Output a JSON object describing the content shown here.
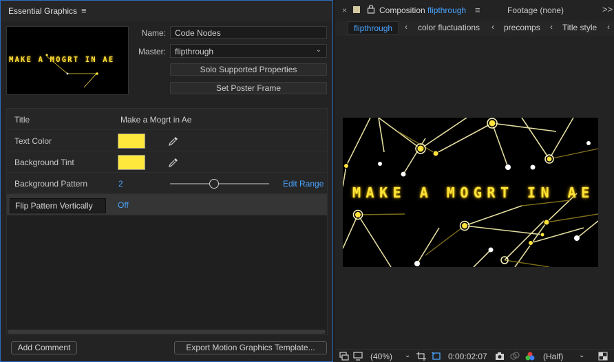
{
  "essential_graphics": {
    "panel_title": "Essential Graphics",
    "menu_icon": "hamburger-menu-icon",
    "thumbnail_text": "MAKE A MOGRT IN AE",
    "name_label": "Name:",
    "name_value": "Code Nodes",
    "master_label": "Master:",
    "master_value": "flipthrough",
    "solo_button": "Solo Supported Properties",
    "poster_button": "Set Poster Frame",
    "properties": {
      "title_label": "Title",
      "title_value": "Make a Mogrt in Ae",
      "text_color_label": "Text Color",
      "text_color": "#ffe83c",
      "bg_tint_label": "Background Tint",
      "bg_tint": "#ffe83c",
      "bg_pattern_label": "Background Pattern",
      "bg_pattern_value": "2",
      "bg_pattern_slider_fraction": 0.45,
      "edit_range": "Edit Range",
      "flip_label": "Flip Pattern Vertically",
      "flip_value": "Off"
    },
    "add_comment": "Add Comment",
    "export_button": "Export Motion Graphics Template..."
  },
  "composition": {
    "close_glyph": "×",
    "tab_prefix": "Composition",
    "tab_comp_name": "flipthrough",
    "footage_tab": "Footage (none)",
    "more_glyph": ">>",
    "breadcrumbs": [
      "flipthrough",
      "color fluctuations",
      "precomps",
      "Title style"
    ],
    "viewer_text": "MAKE A MOGRT IN AE",
    "footer": {
      "zoom": "(40%)",
      "timecode": "0:00:02:07",
      "resolution": "(Half)"
    }
  },
  "colors": {
    "accent_blue": "#4aa3ff",
    "title_yellow": "#ffe53a"
  }
}
